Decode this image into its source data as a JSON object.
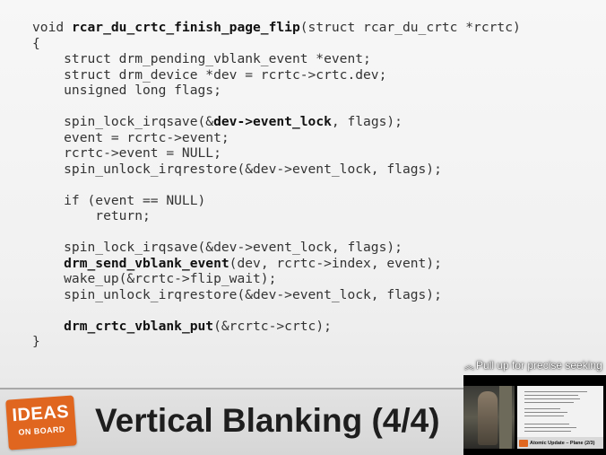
{
  "slide": {
    "code_lines": [
      {
        "segments": [
          {
            "t": "void ",
            "b": false
          },
          {
            "t": "rcar_du_crtc_finish_page_flip",
            "b": true
          },
          {
            "t": "(struct rcar_du_crtc *rcrtc)",
            "b": false
          }
        ]
      },
      {
        "segments": [
          {
            "t": "{",
            "b": false
          }
        ]
      },
      {
        "segments": [
          {
            "t": "    struct drm_pending_vblank_event *event;",
            "b": false
          }
        ]
      },
      {
        "segments": [
          {
            "t": "    struct drm_device *dev = rcrtc->crtc.dev;",
            "b": false
          }
        ]
      },
      {
        "segments": [
          {
            "t": "    unsigned long flags;",
            "b": false
          }
        ]
      },
      {
        "segments": [
          {
            "t": "",
            "b": false
          }
        ]
      },
      {
        "segments": [
          {
            "t": "    spin_lock_irqsave(&",
            "b": false
          },
          {
            "t": "dev->event_lock",
            "b": true
          },
          {
            "t": ", flags);",
            "b": false
          }
        ]
      },
      {
        "segments": [
          {
            "t": "    event = rcrtc->event;",
            "b": false
          }
        ]
      },
      {
        "segments": [
          {
            "t": "    rcrtc->event = NULL;",
            "b": false
          }
        ]
      },
      {
        "segments": [
          {
            "t": "    spin_unlock_irqrestore(&dev->event_lock, flags);",
            "b": false
          }
        ]
      },
      {
        "segments": [
          {
            "t": "",
            "b": false
          }
        ]
      },
      {
        "segments": [
          {
            "t": "    if (event == NULL)",
            "b": false
          }
        ]
      },
      {
        "segments": [
          {
            "t": "        return;",
            "b": false
          }
        ]
      },
      {
        "segments": [
          {
            "t": "",
            "b": false
          }
        ]
      },
      {
        "segments": [
          {
            "t": "    spin_lock_irqsave(&dev->event_lock, flags);",
            "b": false
          }
        ]
      },
      {
        "segments": [
          {
            "t": "    ",
            "b": false
          },
          {
            "t": "drm_send_vblank_event",
            "b": true
          },
          {
            "t": "(dev, rcrtc->index, event);",
            "b": false
          }
        ]
      },
      {
        "segments": [
          {
            "t": "    wake_up(&rcrtc->flip_wait);",
            "b": false
          }
        ]
      },
      {
        "segments": [
          {
            "t": "    spin_unlock_irqrestore(&dev->event_lock, flags);",
            "b": false
          }
        ]
      },
      {
        "segments": [
          {
            "t": "",
            "b": false
          }
        ]
      },
      {
        "segments": [
          {
            "t": "    ",
            "b": false
          },
          {
            "t": "drm_crtc_vblank_put",
            "b": true
          },
          {
            "t": "(&rcrtc->crtc);",
            "b": false
          }
        ]
      },
      {
        "segments": [
          {
            "t": "}",
            "b": false
          }
        ]
      }
    ],
    "title": "Vertical Blanking (4/4)",
    "logo": {
      "line1": "IDEAS",
      "line2": "ON BOARD"
    }
  },
  "player": {
    "seek_hint": "Pull up for precise seeking",
    "seek_hint_icon": "chevron-up-icon",
    "preview_title": "Atomic Update – Plane (2/3)"
  },
  "colors": {
    "accent_orange": "#e0661f",
    "code_text": "#333333",
    "footer_bg": "#d9d9d9"
  }
}
